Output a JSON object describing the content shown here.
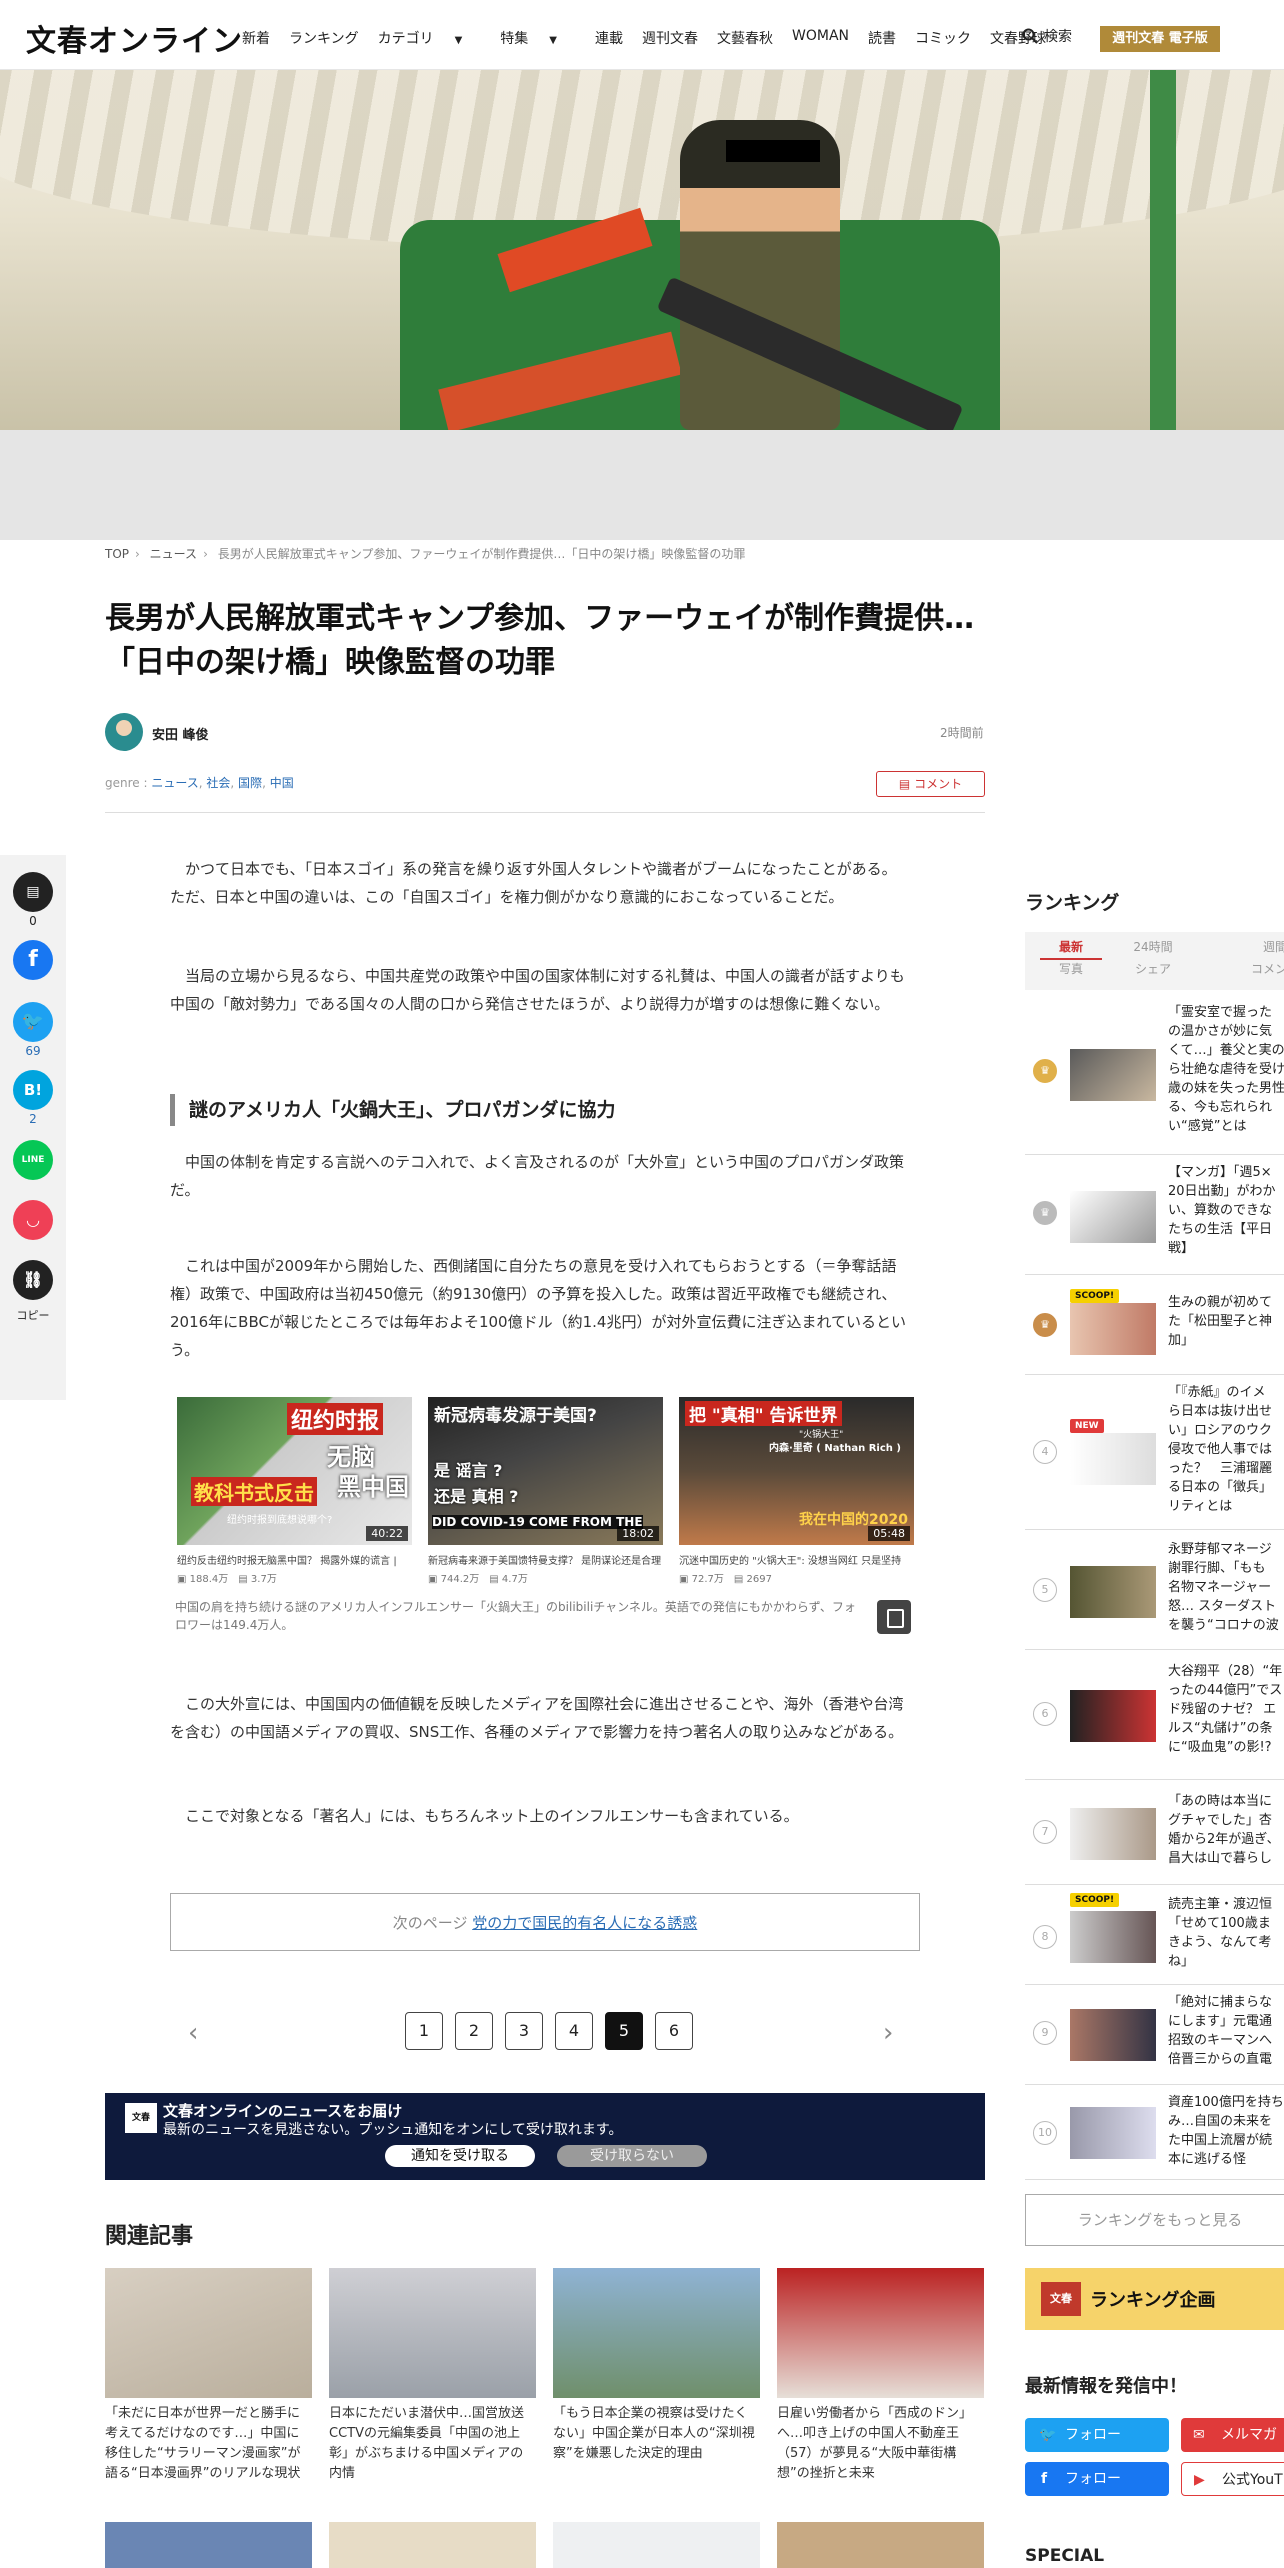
{
  "header": {
    "logo": "文春オンライン",
    "nav": [
      "新着",
      "ランキング",
      "カテゴリ",
      "特集",
      "連載",
      "週刊文春",
      "文藝春秋",
      "WOMAN",
      "読書",
      "コミック",
      "文春野球"
    ],
    "search": "検索",
    "ebook": "週刊文春 電子版"
  },
  "breadcrumb": [
    "TOP",
    "ニュース",
    "長男が人民解放軍式キャンプ参加、ファーウェイが制作費提供…「日中の架け橋」映像監督の功罪"
  ],
  "article": {
    "title": "長男が人民解放軍式キャンプ参加、ファーウェイが制作費提供…「日中の架け橋」映像監督の功罪",
    "author": "安田 峰俊",
    "time": "2時間前",
    "genre_label": "genre : ",
    "genres": [
      "ニュース",
      "社会",
      "国際",
      "中国"
    ],
    "comment_button": "コメント",
    "p1": "　かつて日本でも、「日本スゴイ」系の発言を繰り返す外国人タレントや識者がブームになったことがある。ただ、日本と中国の違いは、この「自国スゴイ」を権力側がかなり意識的におこなっていることだ。",
    "p2": "　当局の立場から見るなら、中国共産党の政策や中国の国家体制に対する礼賛は、中国人の識者が話すよりも中国の「敵対勢力」である国々の人間の口から発信させたほうが、より説得力が増すのは想像に難くない。",
    "heading": "謎のアメリカ人「火鍋大王」、プロパガンダに協力",
    "p3": "　中国の体制を肯定する言説へのテコ入れで、よく言及されるのが「大外宣」という中国のプロパガンダ政策だ。",
    "p4": "　これは中国が2009年から開始した、西側諸国に自分たちの意見を受け入れてもらおうとする（＝争奪話語権）政策で、中国政府は当初450億元（約9130億円）の予算を投入した。政策は習近平政権でも継続され、2016年にBBCが報じたところでは毎年およそ100億ドル（約1.4兆円）が対外宣伝費に注ぎ込まれているという。",
    "videos": [
      {
        "overlay1": "纽约时报",
        "overlay2": "无脑",
        "overlay3": "教科书式反击",
        "overlay4": "黑中国",
        "small": "纽约时报到底想说哪个?",
        "duration": "40:22",
        "caption": "纽约反击纽约时报无脑黑中国？ 揭露外媒的谎言 |",
        "views": "188.4万",
        "comments": "3.7万"
      },
      {
        "overlay1": "新冠病毒发源于美国?",
        "overlay2": "是 谣言 ?",
        "overlay3": "还是 真相 ?",
        "overlay4": "DID COVID-19 COME FROM THE",
        "small": "",
        "duration": "18:02",
        "caption": "新冠病毒来源于美国馈特曼支撑？ 是阴谋论还是合理",
        "views": "744.2万",
        "comments": "4.7万"
      },
      {
        "overlay1": "把 \"真相\" 告诉世界",
        "overlay2": "\"火锅大王\"",
        "overlay3": "内森·里奇 ( Nathan Rich )",
        "overlay4": "我在中国的2020",
        "small": "",
        "duration": "05:48",
        "caption": "沉迷中国历史的 \"火锅大王\": 没想当网红 只是坚持",
        "views": "72.7万",
        "comments": "2697"
      }
    ],
    "video_note": "中国の肩を持ち続ける謎のアメリカ人インフルエンサー「火鍋大王」のbilibiliチャンネル。英語での発信にもかかわらず、フォロワーは149.4万人。",
    "p5": "　この大外宣には、中国国内の価値観を反映したメディアを国際社会に進出させることや、海外（香港や台湾を含む）の中国語メディアの買収、SNS工作、各種のメディアで影響力を持つ著名人の取り込みなどがある。",
    "p6": "　ここで対象となる「著名人」には、もちろんネット上のインフルエンサーも含まれている。",
    "next_prefix": "次のページ ",
    "next_link": "党の力で国民的有名人になる誘惑",
    "pages": [
      "1",
      "2",
      "3",
      "4",
      "5",
      "6"
    ],
    "current_page": "5"
  },
  "share": {
    "comment_count": "0",
    "twitter_count": "69",
    "hatena_count": "2",
    "copy_label": "コピー"
  },
  "push": {
    "icon": "文春",
    "title": "文春オンラインのニュースをお届け",
    "desc": "最新のニュースを見逃さない。プッシュ通知をオンにして受け取れます。",
    "accept": "通知を受け取る",
    "decline": "受け取らない"
  },
  "related": {
    "heading": "関連記事",
    "items": [
      "「未だに日本が世界一だと勝手に考えてるだけなのです…」中国に移住した“サラリーマン漫画家”が語る“日本漫画界”のリアルな現状",
      "日本にただいま潜伏中…国営放送CCTVの元編集委員「中国の池上彰」がぶちまける中国メディアの内情",
      "「もう日本企業の視察は受けたくない」中国企業が日本人の“深圳視察”を嫌悪した決定的理由",
      "日雇い労働者から「西成のドン」へ…叩き上げの中国人不動産王（57）が夢見る“大阪中華街構想”の挫折と未来"
    ]
  },
  "sidebar": {
    "ranking_title": "ランキング",
    "tabs_row1": [
      "最新",
      "24時間",
      "週間"
    ],
    "tabs_row2": [
      "写真",
      "シェア",
      "コメント"
    ],
    "items": [
      {
        "rank": "1",
        "text": "「霊安室で握った\nの温かさが妙に気\nくて…」養父と実の\nら壮絶な虐待を受け\n歳の妹を失った男性\nる、今も忘れられ\nい“感覚”とは",
        "badge": ""
      },
      {
        "rank": "2",
        "text": "【マンガ】「週5×\n20日出勤」がわか\nい、算数のできな\nたちの生活【平日\n戦】",
        "badge": ""
      },
      {
        "rank": "3",
        "text": "生みの親が初めて\nた「松田聖子と神\n加」",
        "badge": "SCOOP!"
      },
      {
        "rank": "4",
        "text": "「『赤紙』のイメ\nら日本は抜け出せ\nい」ロシアのウク\n侵攻で他人事では\nった？　三浦瑠麗\nる日本の「徴兵」\nリティとは",
        "badge": "NEW"
      },
      {
        "rank": "5",
        "text": "永野芽郁マネージ\n謝罪行脚、「もも\n名物マネージャー\n怒… スターダスト\nを襲う“コロナの波",
        "badge": ""
      },
      {
        "rank": "6",
        "text": "大谷翔平（28）“年\nったの44億円”でス\nド残留のナゼ？ エ\nルス“丸儲け”の条\nに“吸血鬼”の影!?",
        "badge": ""
      },
      {
        "rank": "7",
        "text": "「あの時は本当に\nグチャでした」杏\n婚から2年が過ぎ、\n昌大は山で暮らし",
        "badge": ""
      },
      {
        "rank": "8",
        "text": "読売主筆・渡辺恒\n「せめて100歳ま\nきよう、なんて考\nね」",
        "badge": "SCOOP!"
      },
      {
        "rank": "9",
        "text": "「絶対に捕まらな\nにします」元電通\n招致のキーマンへ\n倍晋三からの直電",
        "badge": ""
      },
      {
        "rank": "10",
        "text": "資産100億円を持ち\nみ…自国の未来を\nた中国上流層が続\n本に逃げる怪",
        "badge": ""
      }
    ],
    "more": "ランキングをもっと見る",
    "banner_logo": "文春",
    "banner_text": "ランキング企画",
    "latest": "最新情報を発信中！",
    "follow1": "フォロー",
    "mailmag": "メルマガ",
    "follow2": "フォロー",
    "youtube": "公式YouT",
    "special": "SPECIAL"
  },
  "colors": {
    "accent_gold": "#b08a39",
    "push_bg": "#0e1a3c",
    "twitter": "#1da1f2",
    "facebook": "#1877f2",
    "hatena": "#00a4de",
    "line": "#06c755",
    "pocket": "#ef4056",
    "red": "#cc3333"
  }
}
